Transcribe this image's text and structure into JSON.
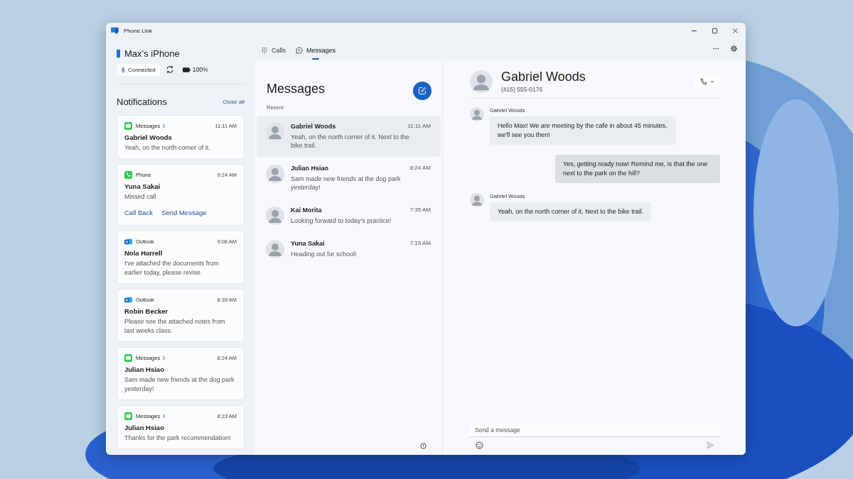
{
  "window": {
    "title": "Phone Link"
  },
  "device": {
    "name": "Max’s iPhone",
    "status": "Connected",
    "battery": "100%"
  },
  "tabs": [
    {
      "label": "Calls",
      "kind": "dialpad",
      "selected": false
    },
    {
      "label": "Messages",
      "kind": "chat",
      "selected": true
    }
  ],
  "notifications": {
    "title": "Notifications",
    "close_all": "Close all",
    "items": [
      {
        "app": "Messages",
        "kind": "messages",
        "has_chevron": true,
        "time": "11:11 AM",
        "sender": "Gabriel Woods",
        "text": "Yeah, on the north corner of it."
      },
      {
        "app": "Phone",
        "kind": "phone",
        "has_chevron": false,
        "time": "9:24 AM",
        "sender": "Yuna Sakai",
        "text": "Missed call",
        "actions": [
          "Call Back",
          "Send Message"
        ]
      },
      {
        "app": "Outlook",
        "kind": "outlook",
        "has_chevron": false,
        "time": "9:06 AM",
        "sender": "Nola Harrell",
        "text": "I've attached the documents from earlier today, please revise."
      },
      {
        "app": "Outlook",
        "kind": "outlook",
        "has_chevron": false,
        "time": "8:39 AM",
        "sender": "Robin Becker",
        "text": "Please see the attached notes from last weeks class."
      },
      {
        "app": "Messages",
        "kind": "messages",
        "has_chevron": true,
        "time": "8:24 AM",
        "sender": "Julian Hsiao",
        "text": "Sam made new friends at the dog park yesterday!"
      },
      {
        "app": "Messages",
        "kind": "messages",
        "has_chevron": true,
        "time": "8:23 AM",
        "sender": "Julian Hsiao",
        "text": "Thanks for the park recommendation!"
      }
    ]
  },
  "conversations": {
    "title": "Messages",
    "section": "Recent",
    "items": [
      {
        "name": "Gabriel Woods",
        "preview": "Yeah, on the north corner of it. Next to the bike trail.",
        "time": "11:11 AM",
        "selected": true
      },
      {
        "name": "Julian Hsiao",
        "preview": "Sam made new friends at the dog park yesterday!",
        "time": "8:24 AM",
        "selected": false
      },
      {
        "name": "Kai Morita",
        "preview": "Looking forward to today's practice!",
        "time": "7:35 AM",
        "selected": false
      },
      {
        "name": "Yuna Sakai",
        "preview": "Heading out for school!",
        "time": "7:15 AM",
        "selected": false
      }
    ]
  },
  "chat": {
    "name": "Gabriel Woods",
    "phone": "(415) 555-0176",
    "messages": [
      {
        "kind": "incoming",
        "sender": "Gabriel Woods",
        "text": "Hello Max! We are meeting by the cafe in about 45 minutes, we'll see you then!"
      },
      {
        "kind": "outgoing",
        "text": "Yes, getting ready now! Remind me, is that the one next to the park on the hill?"
      },
      {
        "kind": "incoming",
        "sender": "Gabriel Woods",
        "text": "Yeah, on the north corner of it. Next to the bike trail."
      }
    ],
    "composer": {
      "placeholder": "Send a message"
    }
  }
}
